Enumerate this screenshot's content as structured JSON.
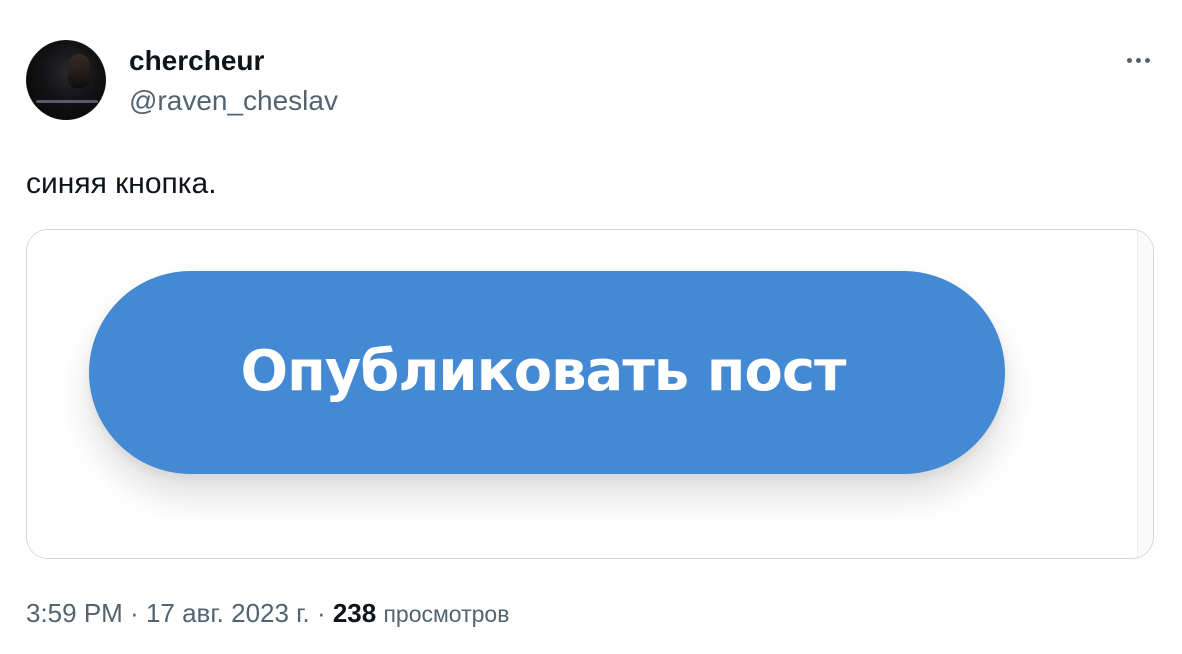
{
  "tweet": {
    "author_name": "chercheur",
    "author_handle": "@raven_cheslav",
    "text": "синяя кнопка.",
    "media_button_label": "Опубликовать пост",
    "time": "3:59 PM",
    "separator": " · ",
    "date": "17 авг. 2023 г.",
    "views_count": "238",
    "views_label": "просмотров"
  },
  "icons": {
    "more": "more-horizontal-icon",
    "avatar": "profile-avatar"
  },
  "colors": {
    "button_blue": "#4389d3",
    "secondary_text": "#536471",
    "primary_text": "#0f1419",
    "card_border": "#cfd9de"
  }
}
